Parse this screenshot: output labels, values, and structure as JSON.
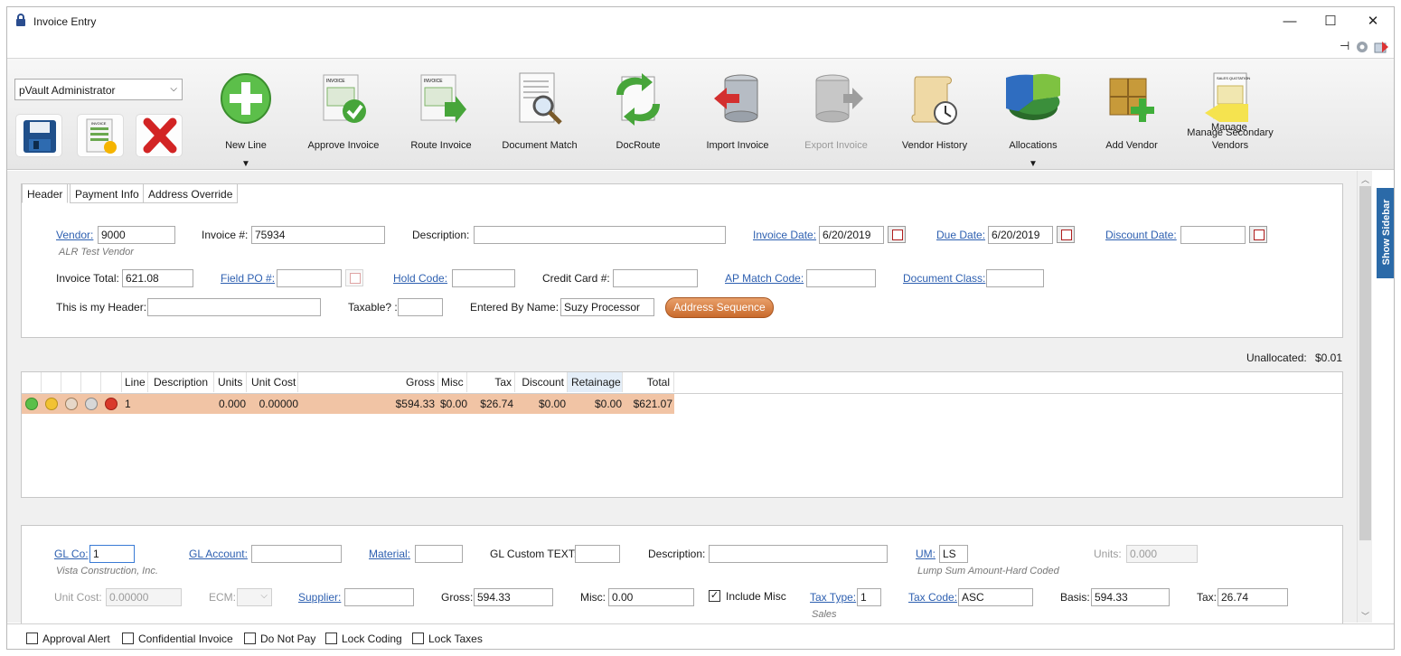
{
  "window": {
    "title": "Invoice Entry"
  },
  "toolbar": {
    "user_select": "pVault Administrator",
    "tools": [
      {
        "label": "New Line",
        "caret": "▼"
      },
      {
        "label": "Approve Invoice"
      },
      {
        "label": "Route Invoice"
      },
      {
        "label": "Document Match"
      },
      {
        "label": "DocRoute"
      },
      {
        "label": "Import Invoice"
      },
      {
        "label": "Export Invoice"
      },
      {
        "label": "Vendor History"
      },
      {
        "label": "Allocations",
        "caret": "▼"
      },
      {
        "label": "Add Vendor"
      },
      {
        "label": "Manage Secondary Vendors",
        "overlay": "Manage"
      }
    ],
    "icon_text": {
      "invoice": "INVOICE",
      "sales_quotation": "SALES QUOTATION"
    }
  },
  "tabs": [
    "Header",
    "Payment Info",
    "Address Override"
  ],
  "header": {
    "vendor_label": "Vendor:",
    "vendor": "9000",
    "vendor_name": "ALR Test Vendor",
    "invoice_no_label": "Invoice #:",
    "invoice_no": "75934",
    "description_label": "Description:",
    "description": "",
    "invoice_date_label": "Invoice Date:",
    "invoice_date": "6/20/2019",
    "due_date_label": "Due Date:",
    "due_date": "6/20/2019",
    "discount_date_label": "Discount Date:",
    "discount_date": "",
    "invoice_total_label": "Invoice Total:",
    "invoice_total": "621.08",
    "field_po_label": "Field PO #:",
    "field_po": "",
    "hold_code_label": "Hold Code:",
    "hold_code": "",
    "credit_card_label": "Credit Card #:",
    "credit_card": "",
    "ap_match_label": "AP Match Code:",
    "ap_match": "",
    "doc_class_label": "Document Class:",
    "doc_class": "",
    "my_header_label": "This is my Header:",
    "my_header": "",
    "taxable_label": "Taxable? :",
    "taxable": "",
    "entered_by_label": "Entered By Name:",
    "entered_by": "Suzy Processor",
    "address_sequence_label": "Address Sequence"
  },
  "unallocated": {
    "label": "Unallocated:",
    "value": "$0.01"
  },
  "grid": {
    "columns": [
      "Line",
      "Description",
      "Units",
      "Unit Cost",
      "Gross",
      "Misc",
      "Tax",
      "Discount",
      "Retainage",
      "Total"
    ],
    "rows": [
      {
        "line": "1",
        "description": "",
        "units": "0.000",
        "unit_cost": "0.00000",
        "gross": "$594.33",
        "misc": "$0.00",
        "tax": "$26.74",
        "discount": "$0.00",
        "retainage": "$0.00",
        "total": "$621.07"
      }
    ]
  },
  "detail": {
    "gl_co_label": "GL Co:",
    "gl_co": "1",
    "gl_co_name": "Vista Construction, Inc.",
    "gl_account_label": "GL Account:",
    "gl_account": "",
    "material_label": "Material:",
    "material": "",
    "gl_custom_label": "GL Custom TEXT:",
    "gl_custom": "",
    "description_label": "Description:",
    "description": "",
    "um_label": "UM:",
    "um": "LS",
    "um_name": "Lump Sum Amount-Hard Coded",
    "units_label": "Units:",
    "units": "0.000",
    "unit_cost_label": "Unit Cost:",
    "unit_cost": "0.00000",
    "ecm_label": "ECM:",
    "ecm": "",
    "supplier_label": "Supplier:",
    "supplier": "",
    "gross_label": "Gross:",
    "gross": "594.33",
    "misc_label": "Misc:",
    "misc": "0.00",
    "include_misc_label": "Include Misc",
    "include_misc_check": "✓",
    "tax_type_label": "Tax Type:",
    "tax_type": "1",
    "tax_type_name": "Sales",
    "tax_code_label": "Tax Code:",
    "tax_code": "ASC",
    "basis_label": "Basis:",
    "basis": "594.33",
    "tax_label": "Tax:",
    "tax": "26.74"
  },
  "status": {
    "approval_alert": "Approval Alert",
    "confidential": "Confidential Invoice",
    "do_not_pay": "Do Not Pay",
    "lock_coding": "Lock Coding",
    "lock_taxes": "Lock Taxes"
  },
  "sidebar": {
    "label": "Show Sidebar"
  },
  "controls": {
    "minimize": "—",
    "maximize": "☐",
    "close": "✕",
    "pin": "⊣"
  }
}
